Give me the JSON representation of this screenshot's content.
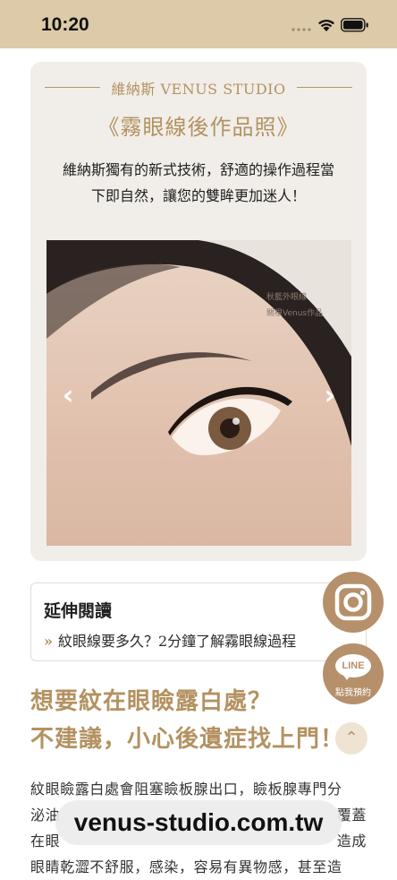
{
  "status_bar": {
    "time": "10:20"
  },
  "card": {
    "studio_label": "維納斯 VENUS STUDIO",
    "title": "《霧眼線後作品照》",
    "description_line1": "維納斯獨有的新式技術，舒適的操作過程當",
    "description_line2": "下即自然，讓您的雙眸更加迷人！",
    "photo_watermark_line1": "秋藍外眼線",
    "photo_watermark_line2": "關根Venus作品",
    "prev_arrow": "‹",
    "next_arrow": "›"
  },
  "extended_reading": {
    "title": "延伸閱讀",
    "link_label": "紋眼線要多久？2分鐘了解霧眼線過程"
  },
  "headline": {
    "line1": "想要紋在眼瞼露白處？",
    "line2": "不建議，小心後遺症找上門！"
  },
  "body": {
    "line1": "紋眼瞼露白處會阻塞瞼板腺出口，瞼板腺專門分",
    "line2": "泌油",
    "line2_end": "覆蓋",
    "line3": "在眼",
    "line3_end": "造成",
    "line4": "眼睛乾澀不舒服，感染，容易有異物感，甚至造"
  },
  "floating": {
    "line_badge": "LINE",
    "line_caption": "點我預約",
    "back_to_top": "⌃"
  },
  "url_bar": {
    "domain": "venus-studio.com.tw"
  },
  "colors": {
    "accent": "#b39261",
    "status_bar": "#dccaa8",
    "card_bg": "#f1eee9",
    "float_btn": "#b5906b"
  },
  "icons": [
    "wifi-icon",
    "battery-icon",
    "instagram-icon",
    "line-icon",
    "chevron-up-icon",
    "double-chevron-icon"
  ]
}
